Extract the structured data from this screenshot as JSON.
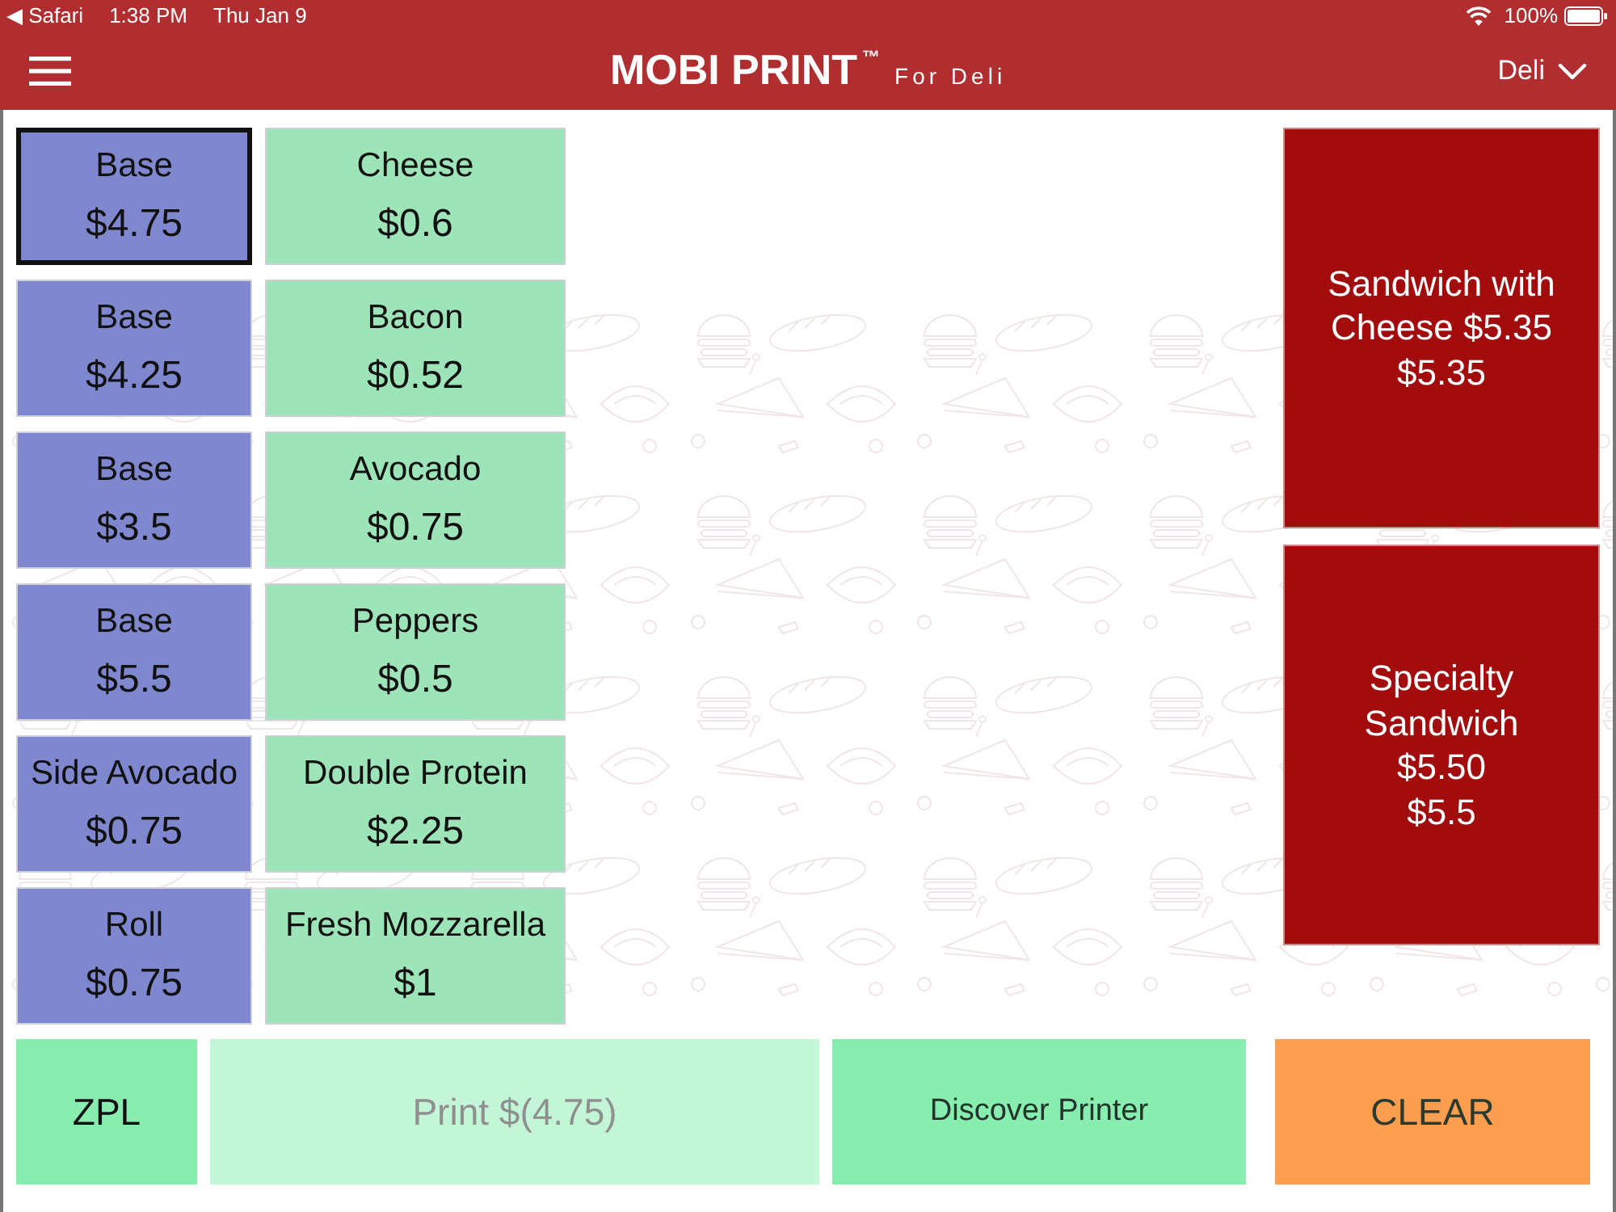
{
  "status_bar": {
    "back_app": "◀ Safari",
    "time": "1:38 PM",
    "date": "Thu Jan 9",
    "battery": "100%"
  },
  "header": {
    "title": "MOBI PRINT$^{™}$",
    "subtitle": "For Deli",
    "store_menu": "Deli"
  },
  "base_items": [
    {
      "name": "Base",
      "price": "$4.75",
      "selected": true
    },
    {
      "name": "Base",
      "price": "$4.25",
      "selected": false
    },
    {
      "name": "Base",
      "price": "$3.5",
      "selected": false
    },
    {
      "name": "Base",
      "price": "$5.5",
      "selected": false
    },
    {
      "name": "Side Avocado",
      "price": "$0.75",
      "selected": false
    },
    {
      "name": "Roll",
      "price": "$0.75",
      "selected": false
    }
  ],
  "addon_items": [
    {
      "name": "Cheese",
      "price": "$0.6",
      "selected": false
    },
    {
      "name": "Bacon",
      "price": "$0.52",
      "selected": false
    },
    {
      "name": "Avocado",
      "price": "$0.75",
      "selected": false
    },
    {
      "name": "Peppers",
      "price": "$0.5",
      "selected": false
    },
    {
      "name": "Double Protein",
      "price": "$2.25",
      "selected": false
    },
    {
      "name": "Fresh Mozzarella",
      "price": "$1",
      "selected": false
    }
  ],
  "sandwiches": [
    {
      "name": "Sandwich with Cheese $5.35",
      "price": "$5.35",
      "selected": false
    },
    {
      "name": "Specialty Sandwich $5.50",
      "price": "$5.5",
      "selected": false
    }
  ],
  "actions": [
    {
      "label": "ZPL",
      "kind": "action",
      "disabled": false
    },
    {
      "label": "Print $(4.75)",
      "kind": "action",
      "disabled": true
    },
    {
      "label": "Discover Printer",
      "kind": "action",
      "disabled": false
    },
    {
      "label": "CLEAR",
      "kind": "clear",
      "disabled": false
    }
  ]
}
